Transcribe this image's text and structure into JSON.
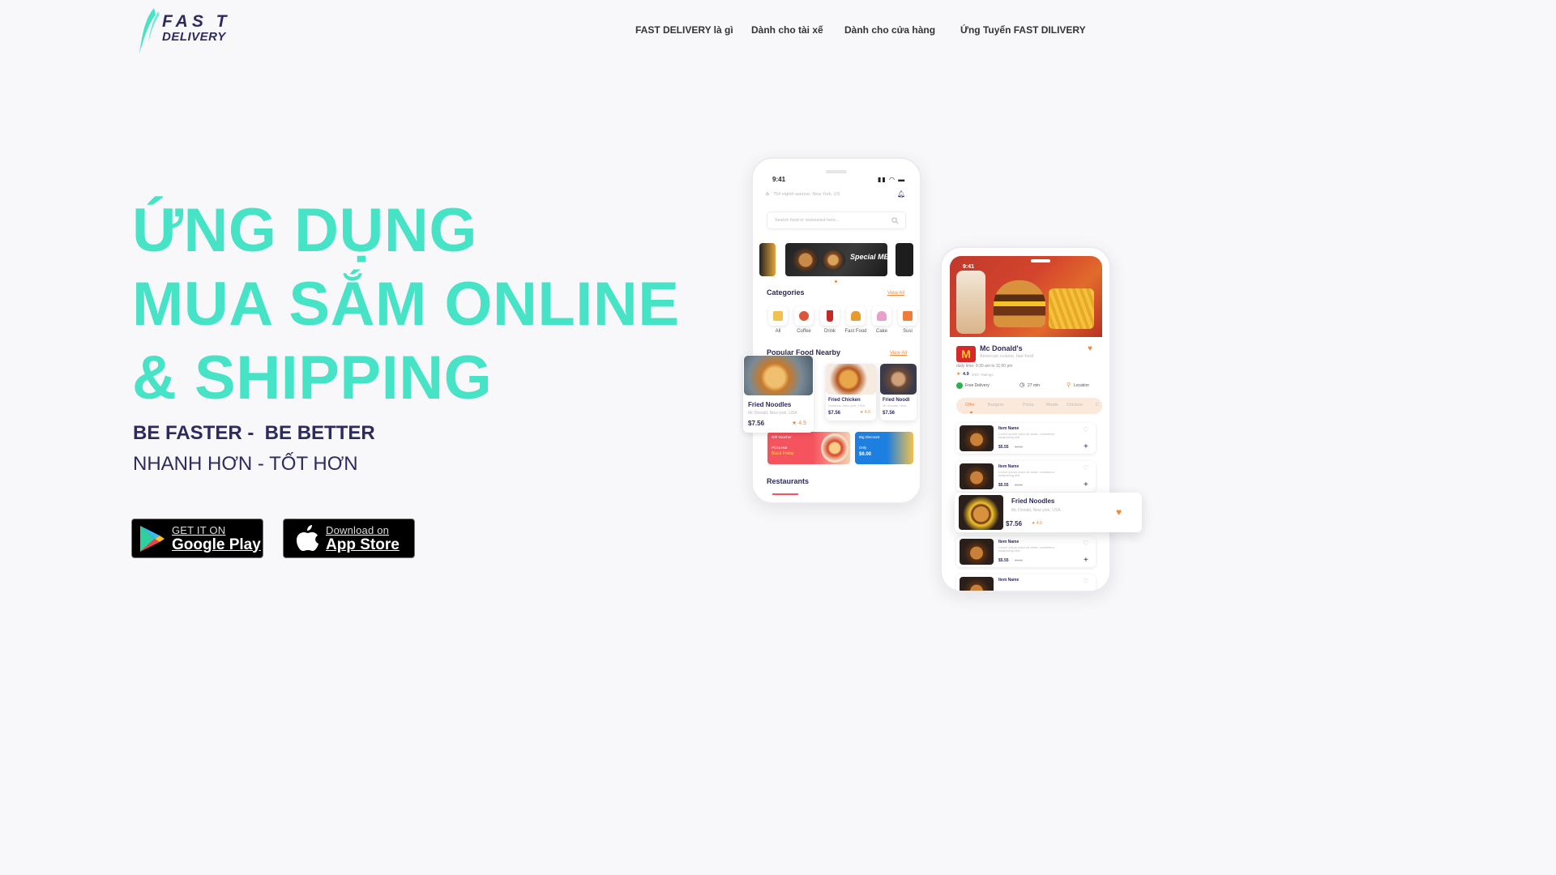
{
  "header": {
    "logo_line1": "FAS T",
    "logo_line2": "DELIVERY",
    "nav": [
      {
        "label": "FAST DELIVERY là gì"
      },
      {
        "label": "Dành cho tài xế"
      },
      {
        "label": "Dành cho cửa hàng"
      },
      {
        "label": "Ứng Tuyển FAST DILIVERY"
      }
    ]
  },
  "hero": {
    "line1": "ỨNG DỤNG",
    "line2": "MUA SẮM ONLINE",
    "line3": "& SHIPPING",
    "tagline": "BE FASTER -  BE BETTER",
    "subtagline": "NHANH HƠN - TỐT HƠN"
  },
  "stores": {
    "google": {
      "small": "GET IT ON",
      "big": "Google Play"
    },
    "apple": {
      "small": "Download on",
      "big": "App Store"
    }
  },
  "phone_home": {
    "time": "9:41",
    "address": "754 eighth avenue, New York, US",
    "search_placeholder": "Search food or restaurant here...",
    "banner_text": "Special MENU",
    "categories_title": "Categories",
    "view_all": "View All",
    "categories": [
      "All",
      "Coffee",
      "Drink",
      "Fast Food",
      "Cake",
      "Susi"
    ],
    "popular_title": "Popular Food Nearby",
    "popular_view_all": "View All",
    "featured": {
      "name": "Fried Noodles",
      "place": "Mc Donald, New york, USA",
      "price": "$7.56",
      "rating": "★ 4.9"
    },
    "cards": [
      {
        "name": "Fried Chicken",
        "place": "Dominos, New york, USA",
        "price": "$7.56",
        "rating": "★ 4.9"
      },
      {
        "name": "Fried Noodl",
        "place": "Mc Donald, New",
        "price": "$7.56"
      }
    ],
    "promo_left": {
      "line1": "Gift Voucher",
      "line2": "Pizza Hut",
      "line3": "Black Friday"
    },
    "promo_right": {
      "line1": "Big Discount",
      "line2": "Only",
      "line3": "$6.00"
    },
    "restaurants_title": "Restaurants"
  },
  "phone_detail": {
    "time": "9:41",
    "restaurant": "Mc Donald's",
    "cuisine": "American cuisine, fast food",
    "hours": "daily time: 9:30 am to 11:00 pm",
    "rating": "4.9",
    "ratings_count": "200+ Ratings",
    "features": [
      "Free Delivery",
      "27 min",
      "Location"
    ],
    "tabs": [
      "Offer",
      "Burgers",
      "Pizza",
      "Meals",
      "Chicken",
      "C"
    ],
    "items": [
      {
        "name": "Item Name",
        "desc": "Lorem ipsum dolor sit amet, consetetur sadipscing elitr,",
        "price": "$5.55",
        "old_price": "$9.50"
      },
      {
        "name": "Item Name",
        "desc": "Lorem ipsum dolor sit amet, consetetur sadipscing elitr,",
        "price": "$5.55",
        "old_price": "$9.50"
      },
      {
        "name": "Item Name",
        "desc": "Lorem ipsum dolor sit amet, consetetur sadipscing elitr,",
        "price": "$5.55",
        "old_price": "$9.50"
      },
      {
        "name": "Item Name"
      }
    ],
    "float_card": {
      "name": "Fried Noodles",
      "place": "Mc Donald, New york, USA",
      "price": "$7.56",
      "rating": "★ 4.9"
    }
  },
  "colors": {
    "accent": "#47e3c6",
    "navy": "#2d2b5e",
    "orange": "#f08a3d"
  }
}
